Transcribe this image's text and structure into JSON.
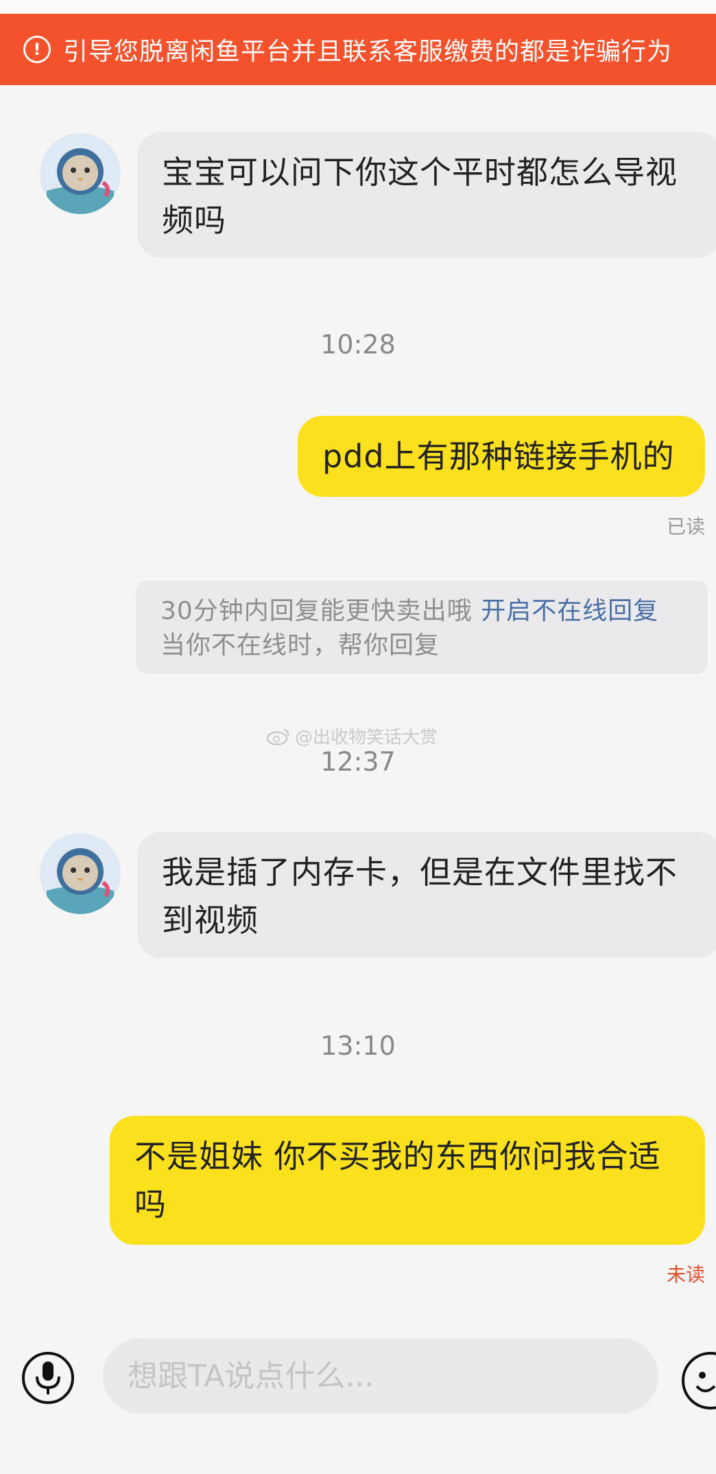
{
  "banner": {
    "text": "引导您脱离闲鱼平台并且联系客服缴费的都是诈骗行为",
    "icon": "warning-circle-icon"
  },
  "messages": [
    {
      "side": "in",
      "text": "宝宝可以问下你这个平时都怎么导视频吗"
    },
    {
      "time": "10:28"
    },
    {
      "side": "out",
      "text": "pdd上有那种链接手机的",
      "status": "已读"
    },
    {
      "system": {
        "text": "30分钟内回复能更快卖出哦",
        "link": "开启不在线回复",
        "sub": "当你不在线时，帮你回复"
      }
    },
    {
      "time": "12:37"
    },
    {
      "side": "in",
      "text": "我是插了内存卡，但是在文件里找不到视频"
    },
    {
      "time": "13:10"
    },
    {
      "side": "out",
      "text": "不是姐妹 你不买我的东西你问我合适吗",
      "status": "未读"
    }
  ],
  "watermark": "@出收物笑话大赏",
  "composer": {
    "placeholder": "想跟TA说点什么..."
  },
  "colors": {
    "banner": "#f4522d",
    "out_bubble": "#fbe11d",
    "in_bubble": "#eaeaec",
    "link": "#4a6fa5",
    "unread": "#e0502c"
  }
}
